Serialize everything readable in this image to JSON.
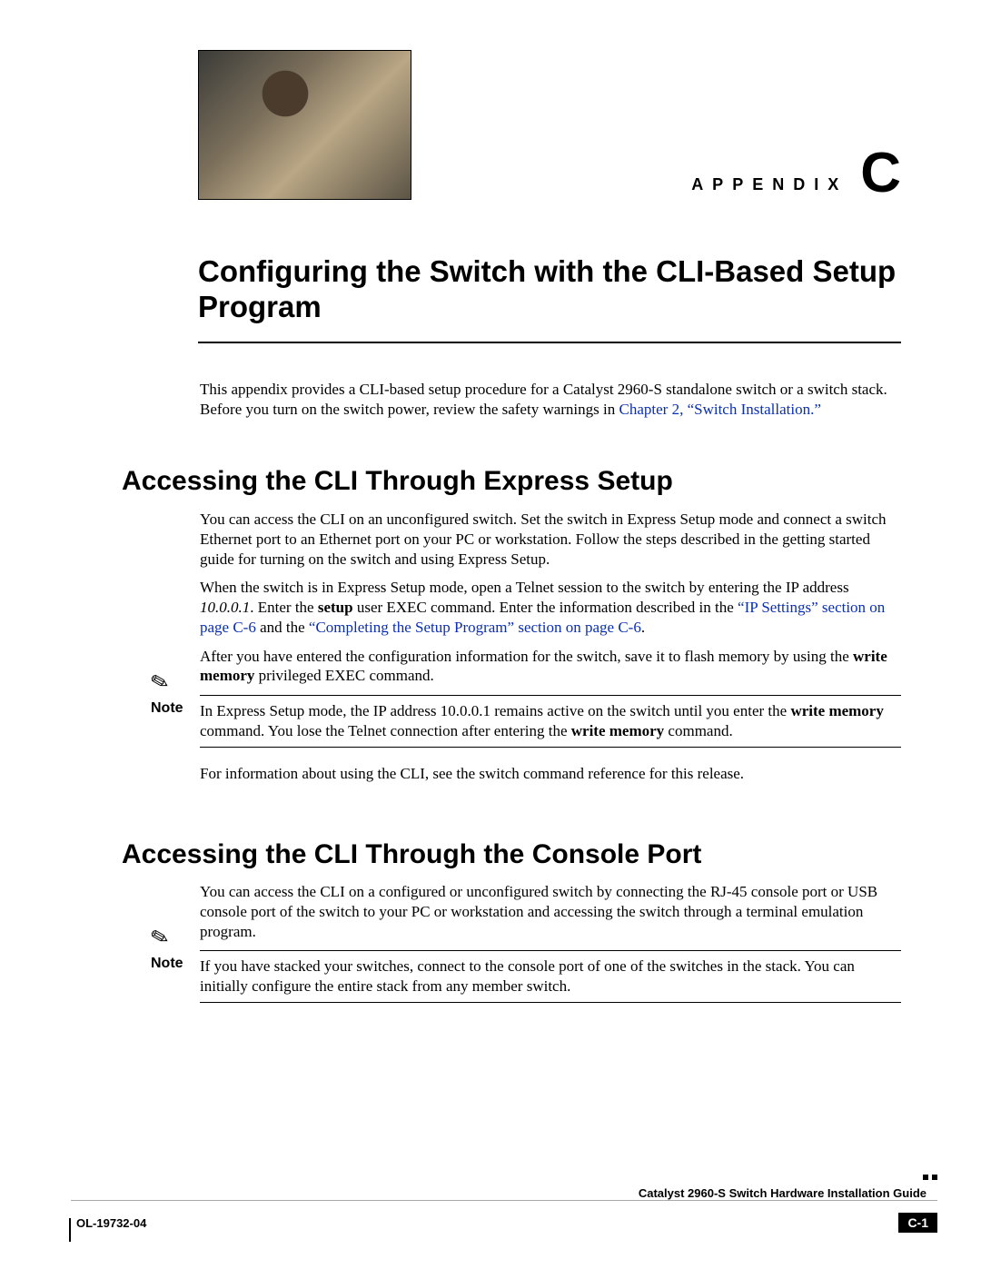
{
  "appendix": {
    "label": "APPENDIX",
    "letter": "C"
  },
  "title": "Configuring the Switch with the CLI-Based Setup Program",
  "intro": {
    "text_a": "This appendix provides a CLI-based setup procedure for a Catalyst 2960-S standalone switch or a switch stack. Before you turn on the switch power, review the safety warnings in ",
    "link": "Chapter 2, “Switch Installation.”"
  },
  "section1": {
    "heading": "Accessing the CLI Through Express Setup",
    "p1": "You can access the CLI on an unconfigured switch. Set the switch in Express Setup mode and connect a switch Ethernet port to an Ethernet port on your PC or workstation. Follow the steps described in the getting started guide for turning on the switch and using Express Setup.",
    "p2_a": "When the switch is in Express Setup mode, open a Telnet session to the switch by entering the IP address ",
    "p2_ip": "10.0.0.1",
    "p2_b": ". Enter the ",
    "p2_bold": "setup",
    "p2_c": " user EXEC command. Enter the information described in the ",
    "p2_link1": "“IP Settings” section on page C-6",
    "p2_d": " and the ",
    "p2_link2": "“Completing the Setup Program” section on page C-6",
    "p2_e": ".",
    "p3_a": "After you have entered the configuration information for the switch, save it to flash memory by using the ",
    "p3_bold": "write memory",
    "p3_b": " privileged EXEC command.",
    "note_label": "Note",
    "note_a": "In Express Setup mode, the IP address 10.0.0.1 remains active on the switch until you enter the ",
    "note_bold1": "write memory",
    "note_b": " command. You lose the Telnet connection after entering the ",
    "note_bold2": "write memory",
    "note_c": " command.",
    "p4": "For information about using the CLI, see the switch command reference for this release."
  },
  "section2": {
    "heading": "Accessing the CLI Through the Console Port",
    "p1": "You can access the CLI on a configured or unconfigured switch by connecting the RJ-45 console port or USB console port of the switch to your PC or workstation and accessing the switch through a terminal emulation program.",
    "note_label": "Note",
    "note": "If you have stacked your switches, connect to the console port of one of the switches in the stack. You can initially configure the entire stack from any member switch."
  },
  "footer": {
    "guide": "Catalyst 2960-S Switch Hardware Installation Guide",
    "code": "OL-19732-04",
    "page": "C-1"
  }
}
